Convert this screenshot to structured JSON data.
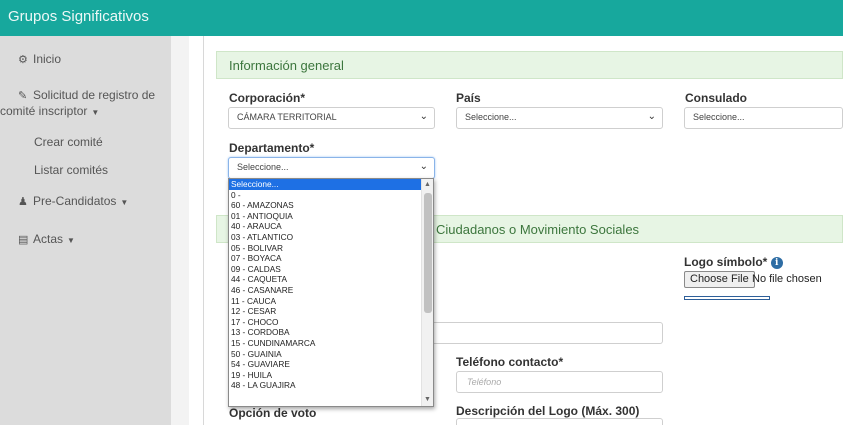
{
  "app": {
    "title": "Grupos Significativos"
  },
  "sidebar": {
    "items": [
      {
        "icon": "dashboard-icon",
        "label": "Inicio"
      },
      {
        "icon": "edit-icon",
        "label_line1": "Solicitud de registro de",
        "label_line2": "comité inscriptor"
      },
      {
        "label": "Crear comité"
      },
      {
        "label": "Listar comités"
      },
      {
        "icon": "users-icon",
        "label": "Pre-Candidatos"
      },
      {
        "icon": "file-icon",
        "label": "Actas"
      }
    ]
  },
  "panel1": {
    "title": "Información general"
  },
  "panel2": {
    "title": "Ciudadanos o Movimiento Sociales"
  },
  "form": {
    "corporacion": {
      "label": "Corporación*",
      "value": "CÁMARA TERRITORIAL"
    },
    "pais": {
      "label": "País",
      "value": "Seleccione..."
    },
    "consulado": {
      "label": "Consulado",
      "value": "Seleccione..."
    },
    "departamento": {
      "label": "Departamento*",
      "value": "Seleccione..."
    },
    "logo": {
      "label": "Logo símbolo*",
      "button": "Choose File",
      "status": "No file chosen"
    },
    "telefono": {
      "label": "Teléfono contacto*",
      "placeholder": "Teléfono"
    },
    "opcion_voto": {
      "label": "Opción de voto"
    },
    "descripcion_logo": {
      "label": "Descripción del Logo (Máx. 300)"
    }
  },
  "dropdown": {
    "options": [
      "Seleccione...",
      "0 -",
      "60 - AMAZONAS",
      "01 - ANTIOQUIA",
      "40 - ARAUCA",
      "03 - ATLANTICO",
      "05 - BOLIVAR",
      "07 - BOYACA",
      "09 - CALDAS",
      "44 - CAQUETA",
      "46 - CASANARE",
      "11 - CAUCA",
      "12 - CESAR",
      "17 - CHOCO",
      "13 - CORDOBA",
      "15 - CUNDINAMARCA",
      "50 - GUAINIA",
      "54 - GUAVIARE",
      "19 - HUILA",
      "48 - LA GUAJIRA"
    ],
    "selected_index": 0
  },
  "colors": {
    "topbar": "#17a89d",
    "panel_header": "#e7f5e4",
    "panel_text": "#3c763d",
    "selection": "#1e70e4"
  }
}
